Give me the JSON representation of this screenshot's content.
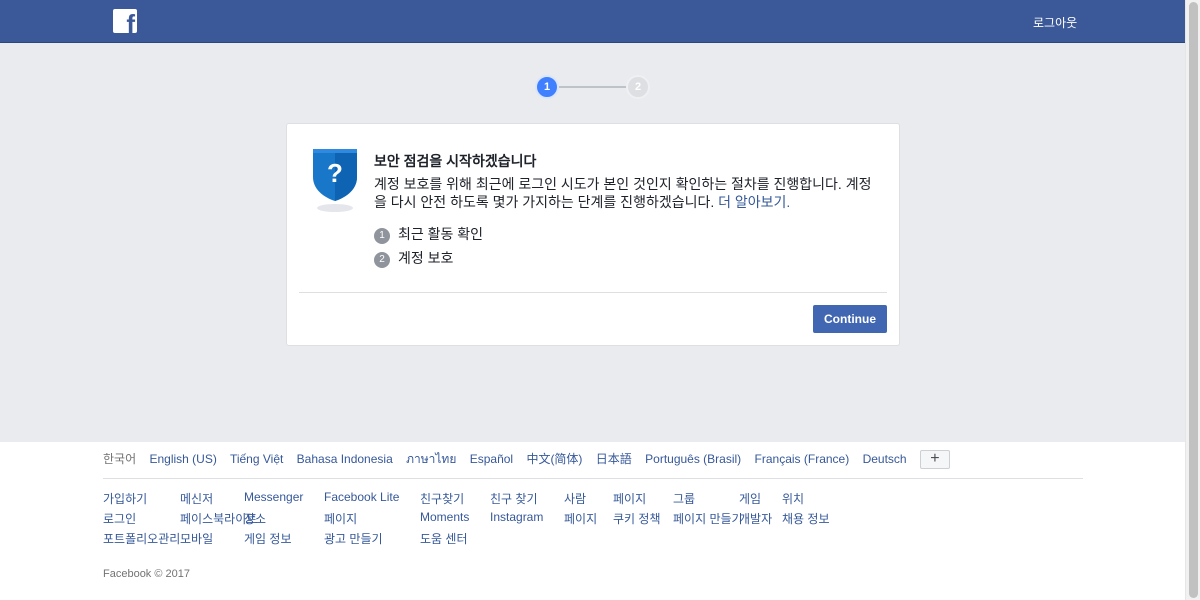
{
  "header": {
    "logo_letter": "f",
    "right_link": "로그아웃"
  },
  "stepper": {
    "steps": [
      "1",
      "2"
    ],
    "current": 1
  },
  "card": {
    "title": "보안 점검을 시작하겠습니다",
    "description": "계정 보호를 위해 최근에 로그인 시도가 본인 것인지 확인하는 절차를 진행합니다. 계정을 다시 안전 하도록 몇가 가지하는 단계를 진행하겠습니다.",
    "learn_more": "더 알아보기.",
    "items": [
      {
        "num": "1",
        "label": "최근 활동 확인"
      },
      {
        "num": "2",
        "label": "계정 보호"
      }
    ],
    "continue_label": "Continue"
  },
  "footer": {
    "languages": [
      "한국어",
      "English (US)",
      "Tiếng Việt",
      "Bahasa Indonesia",
      "ภาษาไทย",
      "Español",
      "中文(简体)",
      "日本語",
      "Português (Brasil)",
      "Français (France)",
      "Deutsch"
    ],
    "more_label": "+",
    "links": {
      "col1": [
        "가입하기",
        "로그인",
        "포트폴리오관리"
      ],
      "col2": [
        "메신저",
        "페이스북라이트",
        "모바일"
      ],
      "col3": [
        "Messenger",
        "장소",
        "게임 정보"
      ],
      "col4": [
        "Facebook Lite",
        "페이지",
        "광고 만들기"
      ],
      "col5": [
        "친구찾기",
        "Moments",
        "도움 센터"
      ],
      "col6": [
        "친구 찾기",
        "Instagram"
      ],
      "col7": [
        "사람",
        "페이지"
      ],
      "col8": [
        "페이지",
        "쿠키 정책"
      ],
      "col9": [
        "그룹",
        "페이지 만들기"
      ],
      "col10": [
        "게임",
        "개발자"
      ],
      "col11": [
        "위치",
        "채용 정보"
      ]
    },
    "copyright": "Facebook © 2017"
  },
  "colors": {
    "brand": "#3b5998",
    "accent": "#4267b2",
    "step_active": "#4080ff",
    "background": "#e9ebee"
  }
}
